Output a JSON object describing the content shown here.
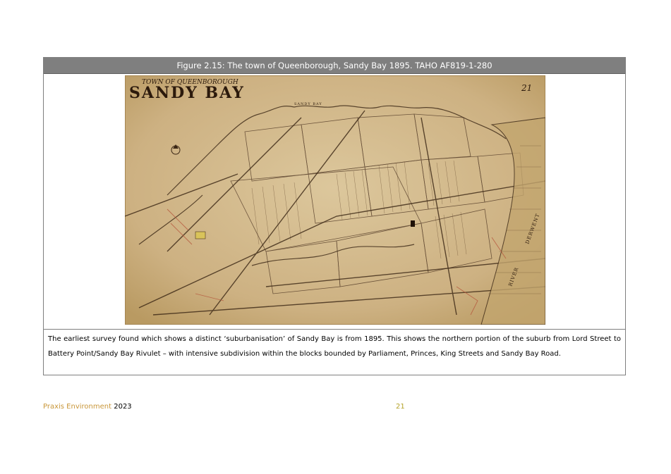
{
  "figure": {
    "caption": "Figure 2.15: The town of Queenborough, Sandy Bay 1895.  TAHO AF819-1-280",
    "map": {
      "heading_small": "TOWN OF QUEENBOROUGH",
      "heading_large": "SANDY BAY",
      "sheet_number": "21",
      "river_label": "RIVER",
      "derwent_label": "DERWENT",
      "bay_label": "SANDY BAY",
      "colors": {
        "paper": "#d2b98a",
        "paper_dark": "#b99a62",
        "ink": "#3a2614",
        "red_ink": "#b5563c"
      }
    },
    "description": "The earliest survey found which shows a distinct ‘suburbanisation’ of Sandy Bay is from 1895.  This shows the northern portion of the suburb from Lord Street to Battery Point/Sandy Bay Rivulet – with intensive subdivision within the blocks bounded by Parliament, Princes, King Streets and Sandy Bay Road."
  },
  "footer": {
    "org": "Praxis Environment",
    "year": "2023",
    "page": "21"
  }
}
